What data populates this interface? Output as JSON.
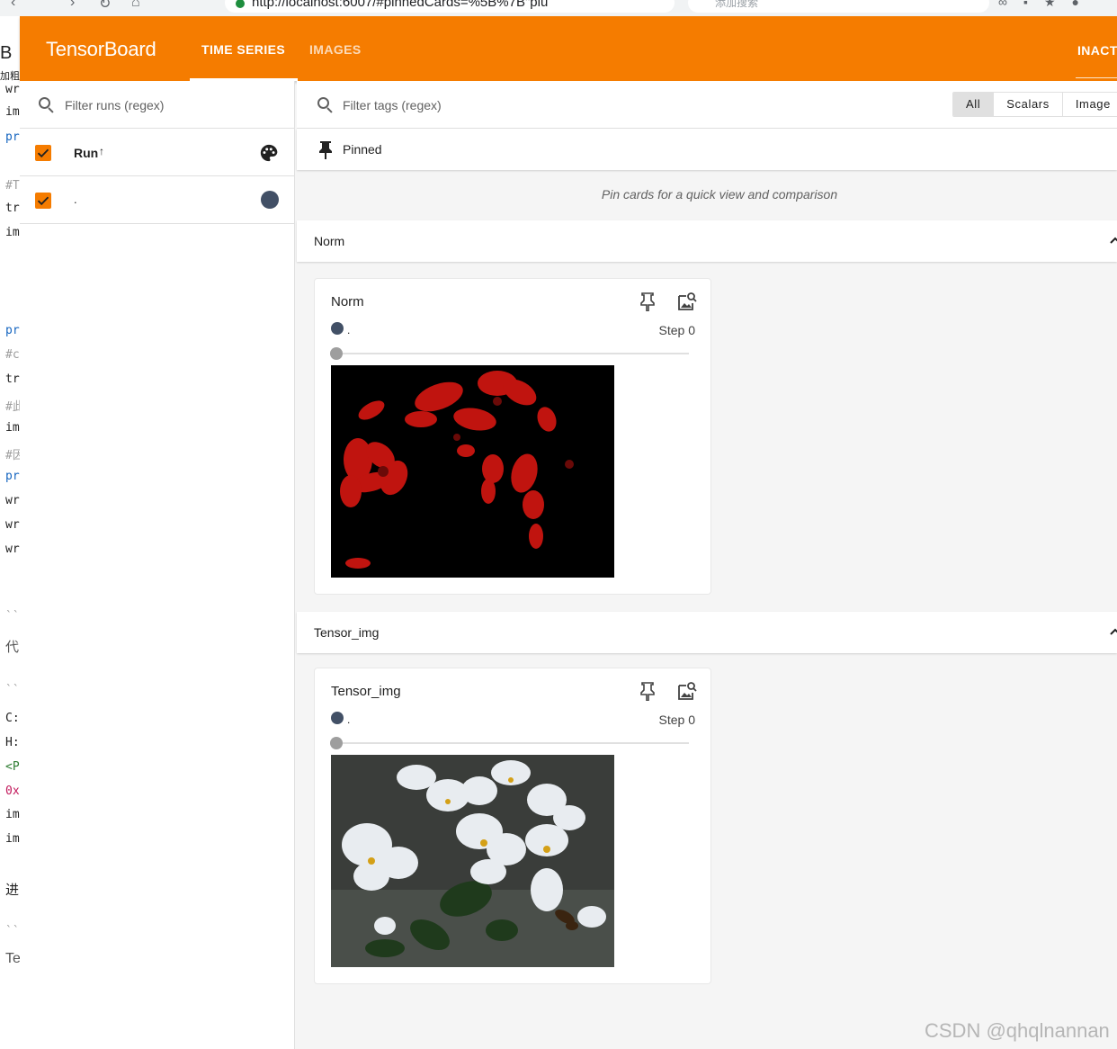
{
  "browser": {
    "url": "http://localhost:6007/#pinnedCards=%5B%7B\"plu",
    "search_placeholder": "添加搜索"
  },
  "editor_gutter": [
    {
      "text": "B"
    },
    {
      "text": "加粗"
    },
    {
      "text": "wr"
    },
    {
      "text": "im"
    },
    {
      "text": "pr"
    },
    {
      "text": "#T"
    },
    {
      "text": "tr"
    },
    {
      "text": "im"
    },
    {
      "text": "pr"
    },
    {
      "text": "#c"
    },
    {
      "text": "tr"
    },
    {
      "text": "#此"
    },
    {
      "text": "im"
    },
    {
      "text": "#因"
    },
    {
      "text": "pr"
    },
    {
      "text": "wr"
    },
    {
      "text": "wr"
    },
    {
      "text": "wr"
    },
    {
      "text": "``"
    },
    {
      "text": "代"
    },
    {
      "text": "``"
    },
    {
      "text": "C:"
    },
    {
      "text": "H:"
    },
    {
      "text": "<P"
    },
    {
      "text": "0x"
    },
    {
      "text": "im"
    },
    {
      "text": "im"
    },
    {
      "text": "进"
    },
    {
      "text": "``"
    },
    {
      "text": "Te"
    }
  ],
  "header": {
    "brand": "TensorBoard",
    "tabs": [
      {
        "label": "TIME SERIES",
        "active": true
      },
      {
        "label": "IMAGES",
        "active": false
      }
    ],
    "inactive_label": "INACTIVE"
  },
  "sidebar": {
    "filter_placeholder": "Filter runs (regex)",
    "run_header": "Run",
    "runs": [
      {
        "name": ".",
        "color": "#425066",
        "checked": true
      }
    ]
  },
  "main": {
    "tag_filter_placeholder": "Filter tags (regex)",
    "type_filters": [
      {
        "label": "All",
        "selected": true
      },
      {
        "label": "Scalars",
        "selected": false
      },
      {
        "label": "Image",
        "selected": false
      }
    ],
    "pinned": {
      "title": "Pinned",
      "hint": "Pin cards for a quick view and comparison"
    },
    "groups": [
      {
        "title": "Norm",
        "card": {
          "title": "Norm",
          "run": ".",
          "step": "Step 0",
          "image": "red-cherry-blossom"
        }
      },
      {
        "title": "Tensor_img",
        "card": {
          "title": "Tensor_img",
          "run": ".",
          "step": "Step 0",
          "image": "white-cherry-blossom-with-bee"
        }
      }
    ]
  },
  "watermark": "CSDN @qhqlnannan",
  "colors": {
    "header": "#f57c00",
    "checkbox": "#f57c00",
    "run_color": "#425066"
  }
}
